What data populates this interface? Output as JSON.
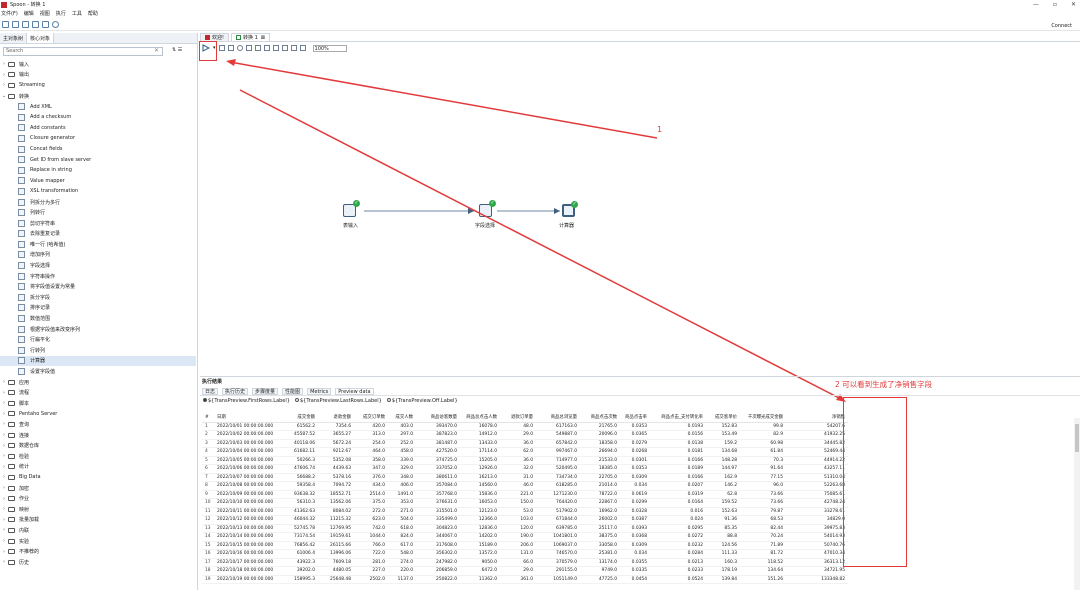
{
  "app": {
    "title": "Spoon - 转换 1",
    "connect_label": "Connect"
  },
  "window_controls": [
    "—",
    "▫",
    "✕"
  ],
  "menu": [
    "文件(F)",
    "编辑",
    "视图",
    "执行",
    "工具",
    "帮助"
  ],
  "left_panel": {
    "tabs": [
      "主对象树",
      "核心对象"
    ],
    "search_placeholder": "Search",
    "tree": [
      {
        "label": "输入",
        "type": "folder",
        "expanded": false
      },
      {
        "label": "输出",
        "type": "folder",
        "expanded": false
      },
      {
        "label": "Streaming",
        "type": "folder",
        "expanded": false
      },
      {
        "label": "转换",
        "type": "folder",
        "expanded": true
      },
      {
        "label": "Add XML",
        "type": "step"
      },
      {
        "label": "Add a checksum",
        "type": "step"
      },
      {
        "label": "Add constants",
        "type": "step"
      },
      {
        "label": "Closure generator",
        "type": "step"
      },
      {
        "label": "Concat fields",
        "type": "step"
      },
      {
        "label": "Get ID from slave server",
        "type": "step"
      },
      {
        "label": "Replace in string",
        "type": "step"
      },
      {
        "label": "Value mapper",
        "type": "step"
      },
      {
        "label": "XSL transformation",
        "type": "step"
      },
      {
        "label": "列拆分为多行",
        "type": "step"
      },
      {
        "label": "列转行",
        "type": "step"
      },
      {
        "label": "剪切字符串",
        "type": "step"
      },
      {
        "label": "去除重复记录",
        "type": "step"
      },
      {
        "label": "唯一行 (哈希值)",
        "type": "step"
      },
      {
        "label": "增加序列",
        "type": "step"
      },
      {
        "label": "字段选择",
        "type": "step"
      },
      {
        "label": "字符串操作",
        "type": "step"
      },
      {
        "label": "将字段值设置为常量",
        "type": "step"
      },
      {
        "label": "拆分字段",
        "type": "step"
      },
      {
        "label": "排序记录",
        "type": "step"
      },
      {
        "label": "数值范围",
        "type": "step"
      },
      {
        "label": "根据字段值来改变序列",
        "type": "step"
      },
      {
        "label": "行扁平化",
        "type": "step"
      },
      {
        "label": "行转列",
        "type": "step"
      },
      {
        "label": "计算器",
        "type": "step",
        "selected": true
      },
      {
        "label": "设置字段值",
        "type": "step"
      },
      {
        "label": "应用",
        "type": "folder",
        "expanded": false
      },
      {
        "label": "流程",
        "type": "folder",
        "expanded": false
      },
      {
        "label": "脚本",
        "type": "folder",
        "expanded": false
      },
      {
        "label": "Pentaho Server",
        "type": "folder",
        "expanded": false
      },
      {
        "label": "查询",
        "type": "folder",
        "expanded": false
      },
      {
        "label": "连接",
        "type": "folder",
        "expanded": false
      },
      {
        "label": "数据仓库",
        "type": "folder",
        "expanded": false
      },
      {
        "label": "检验",
        "type": "folder",
        "expanded": false
      },
      {
        "label": "统计",
        "type": "folder",
        "expanded": false
      },
      {
        "label": "Big Data",
        "type": "folder",
        "expanded": false
      },
      {
        "label": "加密",
        "type": "folder",
        "expanded": false
      },
      {
        "label": "作业",
        "type": "folder",
        "expanded": false
      },
      {
        "label": "映射",
        "type": "folder",
        "expanded": false
      },
      {
        "label": "批量加载",
        "type": "folder",
        "expanded": false
      },
      {
        "label": "内联",
        "type": "folder",
        "expanded": false
      },
      {
        "label": "实验",
        "type": "folder",
        "expanded": false
      },
      {
        "label": "不推荐的",
        "type": "folder",
        "expanded": false
      },
      {
        "label": "历史",
        "type": "folder",
        "expanded": false
      }
    ]
  },
  "editor_tabs": [
    "欢迎!",
    "转换 1"
  ],
  "zoom": "100%",
  "steps": [
    {
      "label": "表输入"
    },
    {
      "label": "字段选择"
    },
    {
      "label": "计算器"
    }
  ],
  "annotations": {
    "a1": "1",
    "a2": "2 可以看到生成了净销售字段"
  },
  "exec": {
    "title": "执行结果",
    "tabs": [
      "日志",
      "执行历史",
      "步骤度量",
      "性能图",
      "Metrics",
      "Preview data"
    ],
    "radios": [
      "${TransPreview.FirstRows.Label}",
      "${TransPreview.LastRows.Label}",
      "${TransPreview.Off.Label}"
    ],
    "columns": [
      "#",
      "日期",
      "成交金额",
      "退款金额",
      "成交订单数",
      "成交人数",
      "商品访客数量",
      "商品总点击人数",
      "退款订单量",
      "商品总浏览量",
      "商品点击次数",
      "商品点击率",
      "商品点击_支付转化率",
      "成交客单价",
      "千次曝光成交金额",
      "净销售"
    ],
    "rows": [
      [
        "1",
        "2022/10/01 00:00:00.000",
        "61562.2",
        "7354.6",
        "420.0",
        "403.0",
        "393470.0",
        "16078.0",
        "48.0",
        "617163.0",
        "21765.0",
        "0.0353",
        "0.0193",
        "152.83",
        "99.8",
        "54207.6"
      ],
      [
        "2",
        "2022/10/02 00:00:00.000",
        "45587.52",
        "3655.27",
        "313.0",
        "297.0",
        "387823.0",
        "14912.0",
        "29.0",
        "549887.0",
        "20096.0",
        "0.0365",
        "0.0156",
        "153.49",
        "82.9",
        "41932.25"
      ],
      [
        "3",
        "2022/10/03 00:00:00.000",
        "40118.06",
        "5672.24",
        "254.0",
        "252.0",
        "381487.0",
        "13433.0",
        "36.0",
        "657842.0",
        "18358.0",
        "0.0279",
        "0.0138",
        "159.2",
        "60.98",
        "34445.82"
      ],
      [
        "4",
        "2022/10/04 00:00:00.000",
        "61682.11",
        "9212.67",
        "464.0",
        "458.0",
        "427520.0",
        "17114.0",
        "62.0",
        "997467.0",
        "26694.0",
        "0.0268",
        "0.0181",
        "134.68",
        "61.84",
        "52469.44"
      ],
      [
        "5",
        "2022/10/05 00:00:00.000",
        "50266.3",
        "5352.08",
        "358.0",
        "339.0",
        "374725.0",
        "15205.0",
        "36.0",
        "714977.0",
        "21533.0",
        "0.0301",
        "0.0166",
        "148.28",
        "70.3",
        "44914.22"
      ],
      [
        "6",
        "2022/10/06 00:00:00.000",
        "47606.74",
        "4439.63",
        "347.0",
        "329.0",
        "337052.0",
        "12926.0",
        "32.0",
        "520495.0",
        "18385.0",
        "0.0353",
        "0.0189",
        "144.97",
        "91.64",
        "43257.11"
      ],
      [
        "7",
        "2022/10/07 00:00:00.000",
        "56688.2",
        "5378.16",
        "376.0",
        "348.0",
        "380611.0",
        "16213.0",
        "31.0",
        "734734.0",
        "22705.0",
        "0.0309",
        "0.0166",
        "162.9",
        "77.15",
        "51310.04"
      ],
      [
        "8",
        "2022/10/08 00:00:00.000",
        "59358.4",
        "7094.72",
        "434.0",
        "406.0",
        "357084.0",
        "14560.0",
        "46.0",
        "618285.0",
        "21014.0",
        "0.034",
        "0.0207",
        "146.2",
        "96.0",
        "52263.68"
      ],
      [
        "9",
        "2022/10/09 00:00:00.000",
        "93638.32",
        "18552.71",
        "2514.0",
        "1491.0",
        "357768.0",
        "15836.0",
        "221.0",
        "1271230.0",
        "78722.0",
        "0.0619",
        "0.0319",
        "62.8",
        "73.66",
        "75085.61"
      ],
      [
        "10",
        "2022/10/10 00:00:00.000",
        "56310.3",
        "13562.06",
        "375.0",
        "353.0",
        "376631.0",
        "16053.0",
        "150.0",
        "764420.0",
        "22867.0",
        "0.0299",
        "0.0164",
        "159.52",
        "73.66",
        "42748.24"
      ],
      [
        "11",
        "2022/10/11 00:00:00.000",
        "41362.63",
        "8084.02",
        "272.0",
        "271.0",
        "315501.0",
        "12123.0",
        "53.0",
        "517902.0",
        "16962.0",
        "0.0328",
        "0.016",
        "152.63",
        "79.87",
        "33278.61"
      ],
      [
        "12",
        "2022/10/12 00:00:00.000",
        "46044.32",
        "11215.32",
        "623.0",
        "504.0",
        "335499.0",
        "12366.0",
        "103.0",
        "671844.0",
        "26002.0",
        "0.0387",
        "0.024",
        "91.36",
        "68.53",
        "34829.0"
      ],
      [
        "13",
        "2022/10/13 00:00:00.000",
        "52745.78",
        "12769.95",
        "742.0",
        "618.0",
        "304823.0",
        "12836.0",
        "120.0",
        "639785.0",
        "25117.0",
        "0.0393",
        "0.0295",
        "85.35",
        "82.44",
        "39975.83"
      ],
      [
        "14",
        "2022/10/14 00:00:00.000",
        "73174.54",
        "19159.61",
        "1044.0",
        "824.0",
        "344067.0",
        "14202.0",
        "190.0",
        "1041801.0",
        "38375.0",
        "0.0368",
        "0.0272",
        "88.8",
        "70.24",
        "54014.93"
      ],
      [
        "15",
        "2022/10/15 00:00:00.000",
        "76856.42",
        "26115.66",
        "766.0",
        "617.0",
        "317608.0",
        "15189.0",
        "206.0",
        "1069037.0",
        "33058.0",
        "0.0309",
        "0.0232",
        "124.56",
        "71.89",
        "50740.76"
      ],
      [
        "16",
        "2022/10/16 00:00:00.000",
        "61006.4",
        "13996.06",
        "722.0",
        "548.0",
        "356302.0",
        "13572.0",
        "131.0",
        "746570.0",
        "25381.0",
        "0.034",
        "0.0284",
        "111.33",
        "81.72",
        "47010.34"
      ],
      [
        "17",
        "2022/10/17 00:00:00.000",
        "43922.3",
        "7609.18",
        "281.0",
        "274.0",
        "247982.0",
        "9050.0",
        "66.0",
        "370579.0",
        "13174.0",
        "0.0355",
        "0.0213",
        "160.3",
        "118.52",
        "36313.12"
      ],
      [
        "18",
        "2022/10/18 00:00:00.000",
        "39202.0",
        "4480.05",
        "227.0",
        "220.0",
        "206859.0",
        "6472.0",
        "29.0",
        "291155.0",
        "9749.0",
        "0.0335",
        "0.0233",
        "178.19",
        "134.64",
        "34721.95"
      ],
      [
        "19",
        "2022/10/19 00:00:00.000",
        "158995.3",
        "25648.48",
        "2502.0",
        "1137.0",
        "250822.0",
        "11362.0",
        "361.0",
        "1051149.0",
        "47725.0",
        "0.0454",
        "0.0524",
        "139.84",
        "151.26",
        "133348.82"
      ]
    ]
  }
}
